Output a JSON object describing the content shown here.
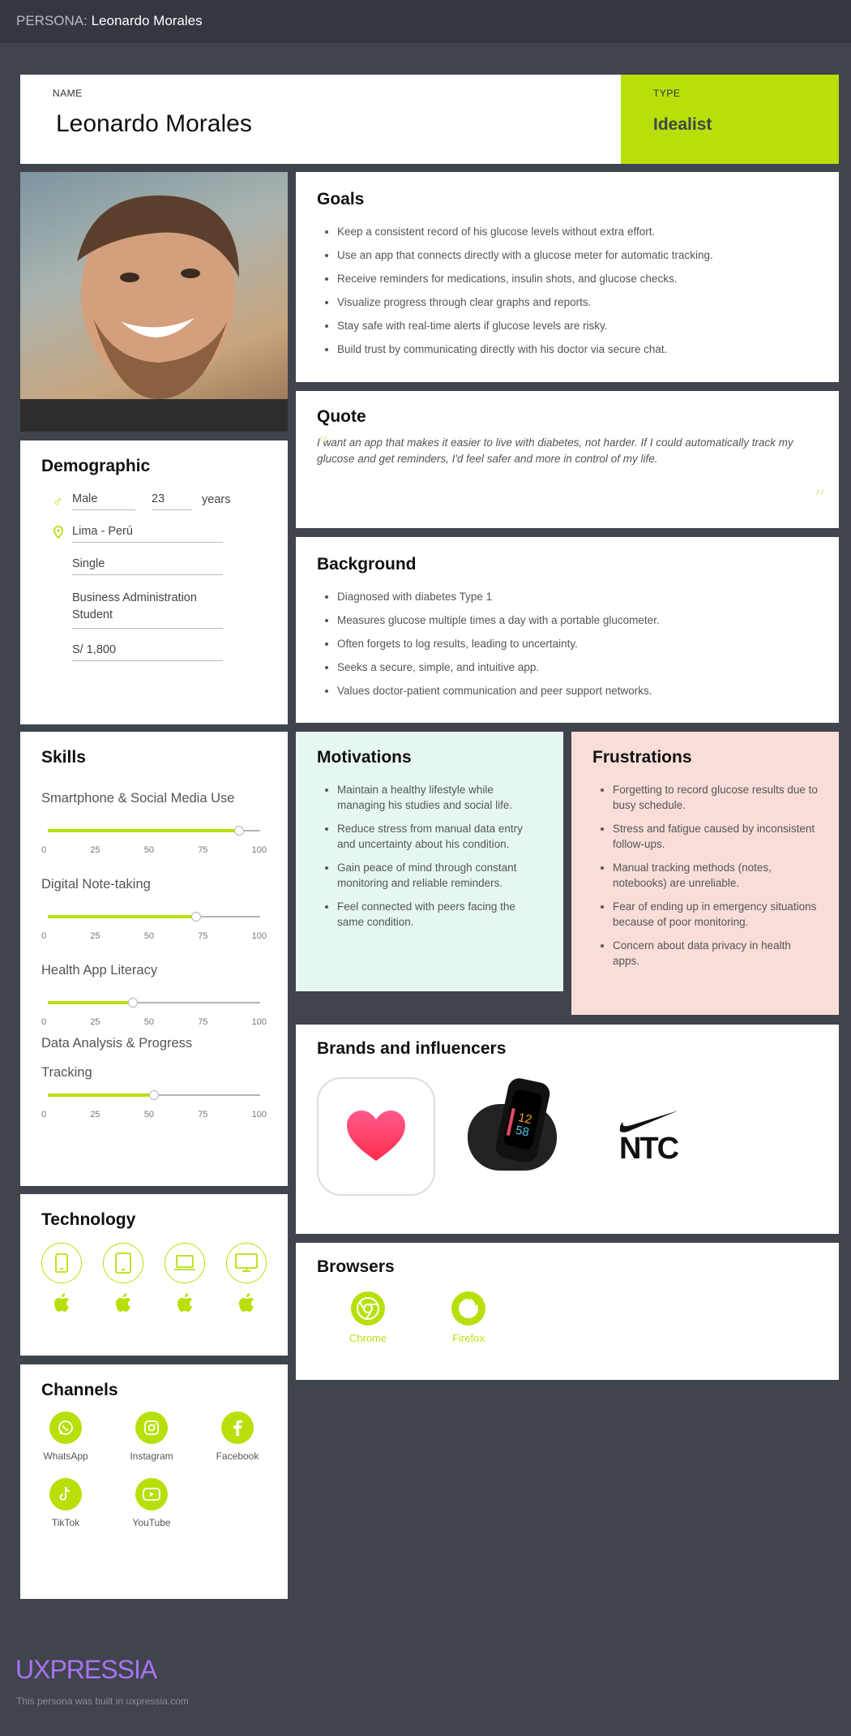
{
  "header": {
    "prefix": "PERSONA:",
    "name": "Leonardo Morales"
  },
  "identity": {
    "name_label": "NAME",
    "name": "Leonardo Morales",
    "type_label": "TYPE",
    "type": "Idealist"
  },
  "demographic": {
    "title": "Demographic",
    "gender": "Male",
    "age": "23",
    "age_unit": "years",
    "location": "Lima - Perú",
    "status": "Single",
    "occupation": "Business Administration Student",
    "income": "S/ 1,800"
  },
  "goals": {
    "title": "Goals",
    "items": [
      "Keep a consistent record of his glucose levels without extra effort.",
      "Use an app that connects directly with a glucose meter for automatic tracking.",
      "Receive reminders for medications, insulin shots, and glucose checks.",
      "Visualize progress through clear graphs and reports.",
      "Stay safe with real-time alerts if glucose levels are risky.",
      "Build trust by communicating directly with his doctor via secure chat."
    ]
  },
  "quote": {
    "title": "Quote",
    "text": "I want an app that makes it easier to live with diabetes, not harder. If I could automatically track my glucose and get reminders, I'd feel safer and more in control of my life."
  },
  "background": {
    "title": "Background",
    "items": [
      "Diagnosed with diabetes Type 1",
      "Measures glucose multiple times a day with a portable glucometer.",
      "Often forgets to log results, leading to uncertainty.",
      "Seeks a secure, simple, and intuitive app.",
      "Values doctor-patient communication and peer support networks."
    ]
  },
  "skills": {
    "title": "Skills",
    "ticks": [
      "0",
      "25",
      "50",
      "75",
      "100"
    ],
    "items": [
      {
        "name": "Smartphone & Social Media Use",
        "value": 90
      },
      {
        "name": "Digital Note-taking",
        "value": 70
      },
      {
        "name": "Health App Literacy",
        "value": 40
      },
      {
        "name": "Data Analysis & Progress Tracking",
        "value": 50
      }
    ]
  },
  "motivations": {
    "title": "Motivations",
    "items": [
      "Maintain a healthy lifestyle while managing his studies and social life.",
      "Reduce stress from manual data entry and uncertainty about his condition.",
      "Gain peace of mind through constant monitoring and reliable reminders.",
      "Feel connected with peers facing the same condition."
    ]
  },
  "frustrations": {
    "title": "Frustrations",
    "items": [
      "Forgetting to record glucose results due to busy schedule.",
      "Stress and fatigue caused by inconsistent follow-ups.",
      "Manual tracking methods (notes, notebooks) are unreliable.",
      "Fear of ending up in emergency situations because of poor monitoring.",
      "Concern about data privacy in health apps."
    ]
  },
  "brands": {
    "title": "Brands and influencers",
    "ntc": "NTC"
  },
  "technology": {
    "title": "Technology",
    "devices": [
      "smartphone-icon",
      "tablet-icon",
      "laptop-icon",
      "desktop-icon"
    ]
  },
  "browsers": {
    "title": "Browsers",
    "items": [
      {
        "label": "Chrome"
      },
      {
        "label": "Firefox"
      }
    ]
  },
  "channels": {
    "title": "Channels",
    "items": [
      "WhatsApp",
      "Instagram",
      "Facebook",
      "TikTok",
      "YouTube"
    ]
  },
  "footer": {
    "logo": "UXPRESSIA",
    "note": "This persona was built in uxpressia.com"
  },
  "colors": {
    "accent": "#b7e00a",
    "dark_bg": "#40444d",
    "motivations_bg": "#e6f7f2",
    "frustrations_bg": "#f9ddd8",
    "logo": "#a872f5"
  }
}
